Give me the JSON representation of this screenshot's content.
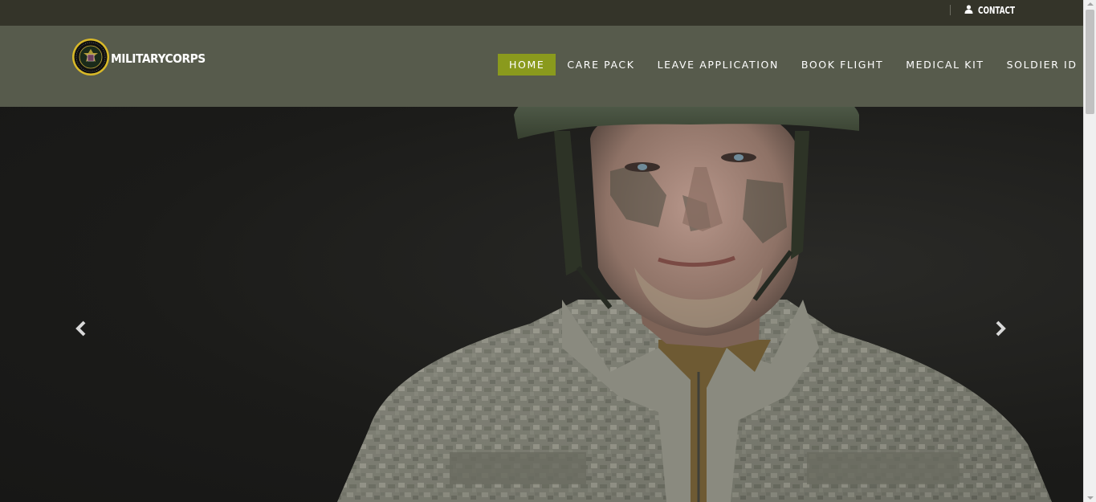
{
  "topbar": {
    "contact_label": "CONTACT",
    "contact_icon": "user-icon"
  },
  "header": {
    "logo_text": "MILITARYCORPS",
    "logo_icon": "army-seal-icon"
  },
  "nav": {
    "items": [
      {
        "label": "HOME",
        "active": true
      },
      {
        "label": "CARE PACK",
        "active": false
      },
      {
        "label": "LEAVE APPLICATION",
        "active": false
      },
      {
        "label": "BOOK FLIGHT",
        "active": false
      },
      {
        "label": "MEDICAL KIT",
        "active": false
      },
      {
        "label": "SOLDIER ID",
        "active": false
      }
    ]
  },
  "hero": {
    "prev_icon": "chevron-left-icon",
    "next_icon": "chevron-right-icon",
    "image_subject": "soldier-photo"
  },
  "colors": {
    "topbar": "#343429",
    "header": "#575b4c",
    "nav_active": "#8a9a1d",
    "hero_bg": "#1b1b19"
  }
}
